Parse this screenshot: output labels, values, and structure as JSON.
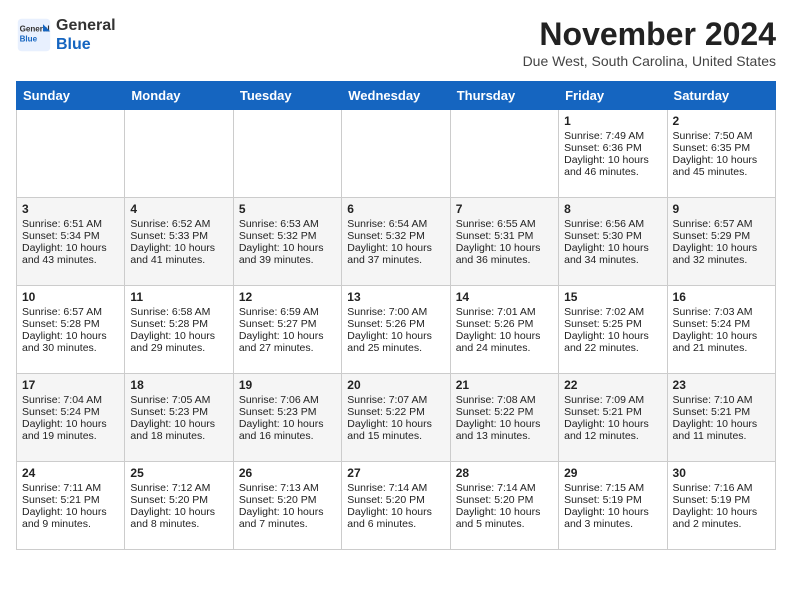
{
  "header": {
    "logo_line1": "General",
    "logo_line2": "Blue",
    "month": "November 2024",
    "location": "Due West, South Carolina, United States"
  },
  "days_of_week": [
    "Sunday",
    "Monday",
    "Tuesday",
    "Wednesday",
    "Thursday",
    "Friday",
    "Saturday"
  ],
  "weeks": [
    [
      {
        "day": "",
        "info": ""
      },
      {
        "day": "",
        "info": ""
      },
      {
        "day": "",
        "info": ""
      },
      {
        "day": "",
        "info": ""
      },
      {
        "day": "",
        "info": ""
      },
      {
        "day": "1",
        "info": "Sunrise: 7:49 AM\nSunset: 6:36 PM\nDaylight: 10 hours and 46 minutes."
      },
      {
        "day": "2",
        "info": "Sunrise: 7:50 AM\nSunset: 6:35 PM\nDaylight: 10 hours and 45 minutes."
      }
    ],
    [
      {
        "day": "3",
        "info": "Sunrise: 6:51 AM\nSunset: 5:34 PM\nDaylight: 10 hours and 43 minutes."
      },
      {
        "day": "4",
        "info": "Sunrise: 6:52 AM\nSunset: 5:33 PM\nDaylight: 10 hours and 41 minutes."
      },
      {
        "day": "5",
        "info": "Sunrise: 6:53 AM\nSunset: 5:32 PM\nDaylight: 10 hours and 39 minutes."
      },
      {
        "day": "6",
        "info": "Sunrise: 6:54 AM\nSunset: 5:32 PM\nDaylight: 10 hours and 37 minutes."
      },
      {
        "day": "7",
        "info": "Sunrise: 6:55 AM\nSunset: 5:31 PM\nDaylight: 10 hours and 36 minutes."
      },
      {
        "day": "8",
        "info": "Sunrise: 6:56 AM\nSunset: 5:30 PM\nDaylight: 10 hours and 34 minutes."
      },
      {
        "day": "9",
        "info": "Sunrise: 6:57 AM\nSunset: 5:29 PM\nDaylight: 10 hours and 32 minutes."
      }
    ],
    [
      {
        "day": "10",
        "info": "Sunrise: 6:57 AM\nSunset: 5:28 PM\nDaylight: 10 hours and 30 minutes."
      },
      {
        "day": "11",
        "info": "Sunrise: 6:58 AM\nSunset: 5:28 PM\nDaylight: 10 hours and 29 minutes."
      },
      {
        "day": "12",
        "info": "Sunrise: 6:59 AM\nSunset: 5:27 PM\nDaylight: 10 hours and 27 minutes."
      },
      {
        "day": "13",
        "info": "Sunrise: 7:00 AM\nSunset: 5:26 PM\nDaylight: 10 hours and 25 minutes."
      },
      {
        "day": "14",
        "info": "Sunrise: 7:01 AM\nSunset: 5:26 PM\nDaylight: 10 hours and 24 minutes."
      },
      {
        "day": "15",
        "info": "Sunrise: 7:02 AM\nSunset: 5:25 PM\nDaylight: 10 hours and 22 minutes."
      },
      {
        "day": "16",
        "info": "Sunrise: 7:03 AM\nSunset: 5:24 PM\nDaylight: 10 hours and 21 minutes."
      }
    ],
    [
      {
        "day": "17",
        "info": "Sunrise: 7:04 AM\nSunset: 5:24 PM\nDaylight: 10 hours and 19 minutes."
      },
      {
        "day": "18",
        "info": "Sunrise: 7:05 AM\nSunset: 5:23 PM\nDaylight: 10 hours and 18 minutes."
      },
      {
        "day": "19",
        "info": "Sunrise: 7:06 AM\nSunset: 5:23 PM\nDaylight: 10 hours and 16 minutes."
      },
      {
        "day": "20",
        "info": "Sunrise: 7:07 AM\nSunset: 5:22 PM\nDaylight: 10 hours and 15 minutes."
      },
      {
        "day": "21",
        "info": "Sunrise: 7:08 AM\nSunset: 5:22 PM\nDaylight: 10 hours and 13 minutes."
      },
      {
        "day": "22",
        "info": "Sunrise: 7:09 AM\nSunset: 5:21 PM\nDaylight: 10 hours and 12 minutes."
      },
      {
        "day": "23",
        "info": "Sunrise: 7:10 AM\nSunset: 5:21 PM\nDaylight: 10 hours and 11 minutes."
      }
    ],
    [
      {
        "day": "24",
        "info": "Sunrise: 7:11 AM\nSunset: 5:21 PM\nDaylight: 10 hours and 9 minutes."
      },
      {
        "day": "25",
        "info": "Sunrise: 7:12 AM\nSunset: 5:20 PM\nDaylight: 10 hours and 8 minutes."
      },
      {
        "day": "26",
        "info": "Sunrise: 7:13 AM\nSunset: 5:20 PM\nDaylight: 10 hours and 7 minutes."
      },
      {
        "day": "27",
        "info": "Sunrise: 7:14 AM\nSunset: 5:20 PM\nDaylight: 10 hours and 6 minutes."
      },
      {
        "day": "28",
        "info": "Sunrise: 7:14 AM\nSunset: 5:20 PM\nDaylight: 10 hours and 5 minutes."
      },
      {
        "day": "29",
        "info": "Sunrise: 7:15 AM\nSunset: 5:19 PM\nDaylight: 10 hours and 3 minutes."
      },
      {
        "day": "30",
        "info": "Sunrise: 7:16 AM\nSunset: 5:19 PM\nDaylight: 10 hours and 2 minutes."
      }
    ]
  ]
}
